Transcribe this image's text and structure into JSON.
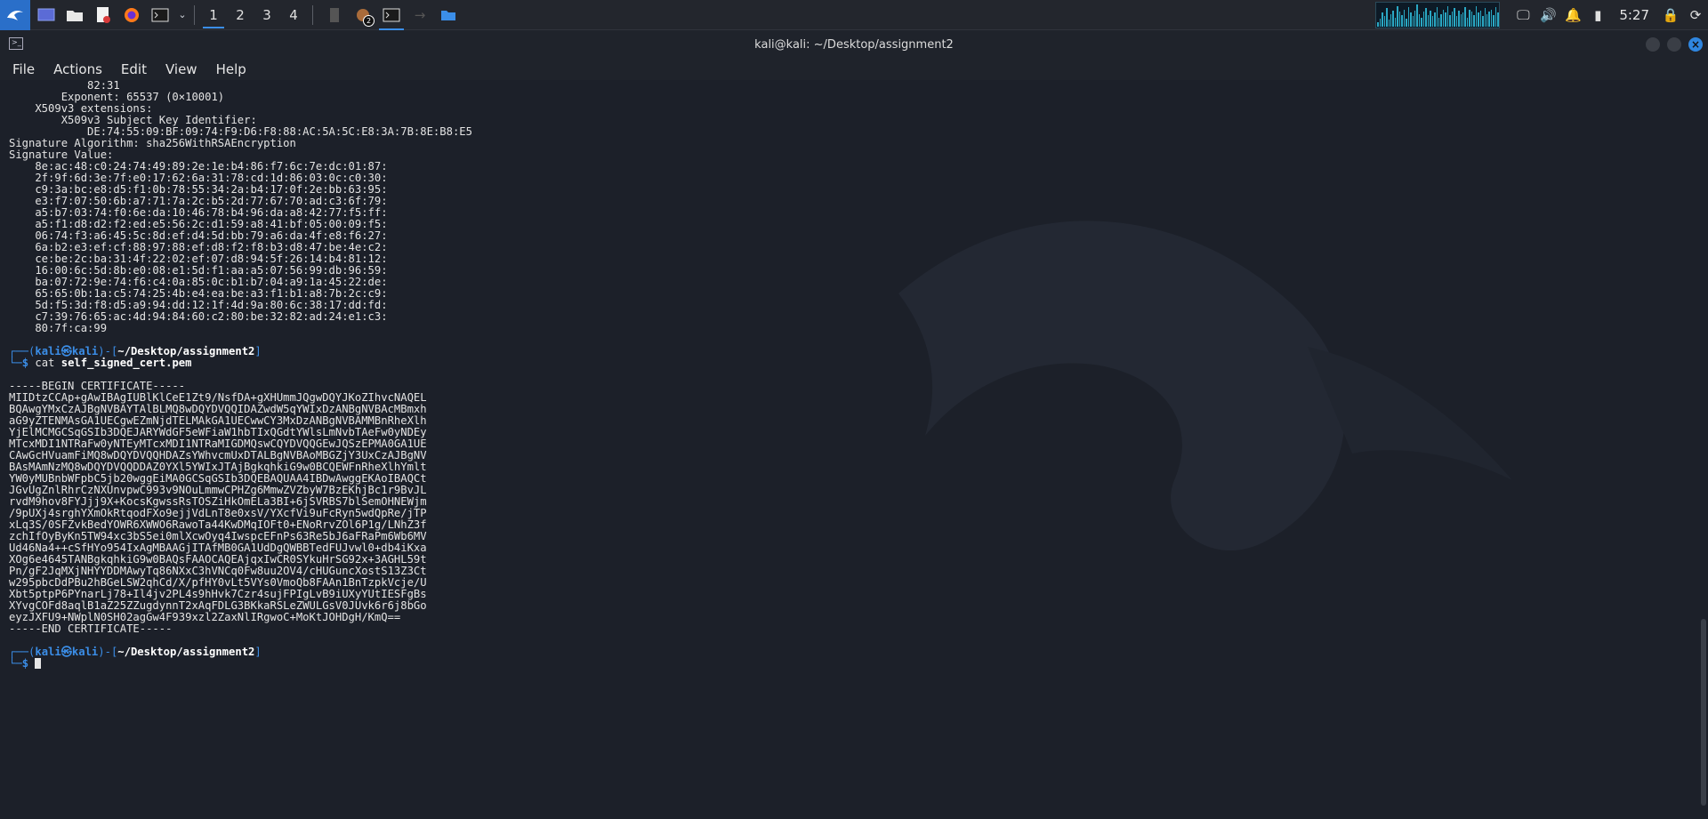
{
  "taskbar": {
    "workspaces": [
      "1",
      "2",
      "3",
      "4"
    ],
    "active_workspace": "1",
    "badge_count": "2",
    "clock": "5:27",
    "launcher_icons": [
      "kali-menu-icon",
      "desktop-icon",
      "files-icon",
      "text-editor-icon",
      "firefox-icon",
      "terminal-icon"
    ]
  },
  "window": {
    "title": "kali@kali: ~/Desktop/assignment2",
    "menus": [
      "File",
      "Actions",
      "Edit",
      "View",
      "Help"
    ]
  },
  "terminal": {
    "top_lines": [
      "            82:31",
      "        Exponent: 65537 (0×10001)",
      "    X509v3 extensions:",
      "        X509v3 Subject Key Identifier:",
      "            DE:74:55:09:BF:09:74:F9:D6:F8:88:AC:5A:5C:E8:3A:7B:8E:B8:E5",
      "Signature Algorithm: sha256WithRSAEncryption",
      "Signature Value:",
      "    8e:ac:48:c0:24:74:49:89:2e:1e:b4:86:f7:6c:7e:dc:01:87:",
      "    2f:9f:6d:3e:7f:e0:17:62:6a:31:78:cd:1d:86:03:0c:c0:30:",
      "    c9:3a:bc:e8:d5:f1:0b:78:55:34:2a:b4:17:0f:2e:bb:63:95:",
      "    e3:f7:07:50:6b:a7:71:7a:2c:b5:2d:77:67:70:ad:c3:6f:79:",
      "    a5:b7:03:74:f0:6e:da:10:46:78:b4:96:da:a8:42:77:f5:ff:",
      "    a5:f1:d8:d2:f2:ed:e5:56:2c:d1:59:a8:41:bf:05:00:09:f5:",
      "    06:74:f3:a6:45:5c:8d:ef:d4:5d:bb:79:a6:da:4f:e8:f6:27:",
      "    6a:b2:e3:ef:cf:88:97:88:ef:d8:f2:f8:b3:d8:47:be:4e:c2:",
      "    ce:be:2c:ba:31:4f:22:02:ef:07:d8:94:5f:26:14:b4:81:12:",
      "    16:00:6c:5d:8b:e0:08:e1:5d:f1:aa:a5:07:56:99:db:96:59:",
      "    ba:07:72:9e:74:f6:c4:0a:85:0c:b1:b7:04:a9:1a:45:22:de:",
      "    65:65:0b:1a:c5:74:25:4b:e4:ea:be:a3:f1:b1:a8:7b:2c:c9:",
      "    5d:f5:3d:f8:d5:a9:94:dd:12:1f:4d:9a:80:6c:38:17:dd:fd:",
      "    c7:39:76:65:ac:4d:94:84:60:c2:80:be:32:82:ad:24:e1:c3:",
      "    80:7f:ca:99"
    ],
    "prompt": {
      "line1_prefix": "┌──(",
      "user": "kali",
      "at": "㉿",
      "host": "kali",
      "mid": ")-[",
      "path": "~/Desktop/assignment2",
      "end": "]",
      "line2_prefix": "└─",
      "dollar": "$"
    },
    "command_cat": "cat",
    "command_arg": "self_signed_cert.pem",
    "cert_lines": [
      "-----BEGIN CERTIFICATE-----",
      "MIIDtzCCAp+gAwIBAgIUBlKlCeE1Zt9/NsfDA+gXHUmmJQgwDQYJKoZIhvcNAQEL",
      "BQAwgYMxCzAJBgNVBAYTAlBLMQ8wDQYDVQQIDAZwdW5qYWIxDzANBgNVBAcMBmxh",
      "aG9yZTENMAsGA1UECgwEZmNjdTELMAkGA1UECwwCY3MxDzANBgNVBAMMBnRheXlh",
      "YjElMCMGCSqGSIb3DQEJARYWdGF5eWFiaW1hbTIxQGdtYWlsLmNvbTAeFw0yNDEy",
      "MTcxMDI1NTRaFw0yNTEyMTcxMDI1NTRaMIGDMQswCQYDVQQGEwJQSzEPMA0GA1UE",
      "CAwGcHVuamFiMQ8wDQYDVQQHDAZsYWhvcmUxDTALBgNVBAoMBGZjY3UxCzAJBgNV",
      "BAsMAmNzMQ8wDQYDVQQDDAZ0YXl5YWIxJTAjBgkqhkiG9w0BCQEWFnRheXlhYmlt",
      "YW0yMUBnbWFpbC5jb20wggEiMA0GCSqGSIb3DQEBAQUAA4IBDwAwggEKAoIBAQCt",
      "JGvUgZnlRhrCzNXUnvpwC993v9NOuLmmwCPHZg6MmwZVZbyW7BzEKhjBc1r9BvJL",
      "rvdM9hov8FYJjj9X+KocsKgwssRsTOSZiHkOmELa3BI+6jSVRBS7blSemOHNEWjm",
      "/9pUXj4srghYXmOkRtqodFXo9ejjVdLnT8e0xsV/YXcfVi9uFcRyn5wdQpRe/jTP",
      "xLq3S/0SFZvkBedYOWR6XWWO6RawoTa44KwDMqIOFt0+ENoRrvZOl6P1g/LNhZ3f",
      "zchIfOyByKn5TW94xc3bS5ei0mlXcwOyq4IwspcEFnPs63Re5bJ6aFRaPm6Wb6MV",
      "Ud46Na4++cSfHYo954IxAgMBAAGjITAfMB0GA1UdDgQWBBTedFUJvwl0+db4iKxa",
      "XOg6e4645TANBgkqhkiG9w0BAQsFAAOCAQEAjqxIwCR0SYkuHrSG92x+3AGHL59t",
      "Pn/gF2JqMXjNHYYDDMAwyTq86NXxC3hVNCq0Fw8uu2OV4/cHUGuncXostS13Z3Ct",
      "w295pbcDdPBu2hBGeLSW2qhCd/X/pfHY0vLt5VYs0VmoQb8FAAn1BnTzpkVcje/U",
      "Xbt5ptpP6PYnarLj78+Il4jv2PL4s9hHvk7Czr4sujFPIgLvB9iUXyYUtIESFgBs",
      "XYvgCOFd8aqlB1aZ25ZZugdynnT2xAqFDLG3BKkaRSLeZWULGsV0JUvk6r6j8bGo",
      "eyzJXFU9+NWplN0SH02agGw4F939xzl2ZaxNlIRgwoC+MoKtJOHDgH/KmQ==",
      "-----END CERTIFICATE-----"
    ]
  },
  "colors": {
    "prompt_blue": "#3b8ee8",
    "background": "#1c2029",
    "taskbar": "#23262d"
  }
}
